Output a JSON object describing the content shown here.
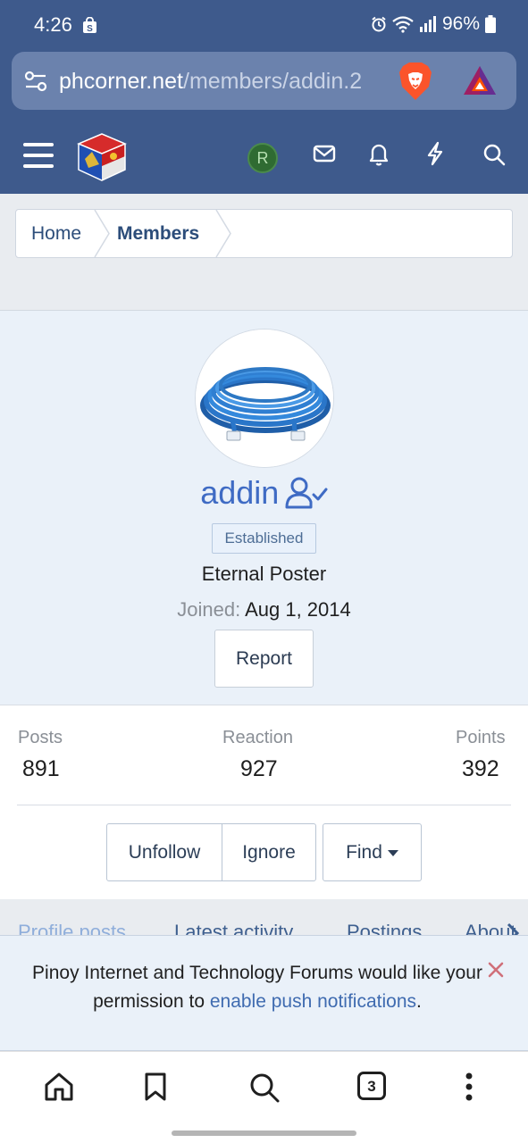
{
  "status_bar": {
    "time": "4:26",
    "battery": "96%",
    "icons": [
      "shopping-bag-icon",
      "alarm-icon",
      "wifi-icon",
      "signal-icon",
      "battery-icon"
    ]
  },
  "browser": {
    "url_domain": "phcorner.net",
    "url_path": "/members/addin.2",
    "icons": [
      "site-settings-icon",
      "brave-lion-icon",
      "bat-rewards-icon"
    ]
  },
  "site_header": {
    "user_initial": "R",
    "icons": [
      "menu-icon",
      "site-logo",
      "inbox-icon",
      "bell-icon",
      "bolt-icon",
      "search-icon"
    ]
  },
  "breadcrumb": {
    "items": [
      "Home",
      "Members"
    ]
  },
  "profile": {
    "name": "addin",
    "badge": "Established",
    "user_title": "Eternal Poster",
    "joined_label": "Joined:",
    "joined_date": "Aug 1, 2014",
    "report_label": "Report"
  },
  "stats": {
    "posts_label": "Posts",
    "posts_value": "891",
    "reaction_label": "Reaction",
    "reaction_value": "927",
    "points_label": "Points",
    "points_value": "392"
  },
  "actions": {
    "unfollow": "Unfollow",
    "ignore": "Ignore",
    "find": "Find"
  },
  "tabs": [
    "Profile posts",
    "Latest activity",
    "Postings",
    "About"
  ],
  "notice": {
    "text_before": "Pinoy Internet and Technology Forums would like your permission to ",
    "link": "enable push notifications",
    "text_after": "."
  },
  "bottom_nav": {
    "tab_count": "3",
    "icons": [
      "home-icon",
      "bookmark-icon",
      "search-icon",
      "tabs-icon",
      "more-icon"
    ]
  },
  "colors": {
    "header_bg": "#3e5a8c",
    "profile_bg": "#eaf1f9",
    "link": "#3f6bc4"
  }
}
